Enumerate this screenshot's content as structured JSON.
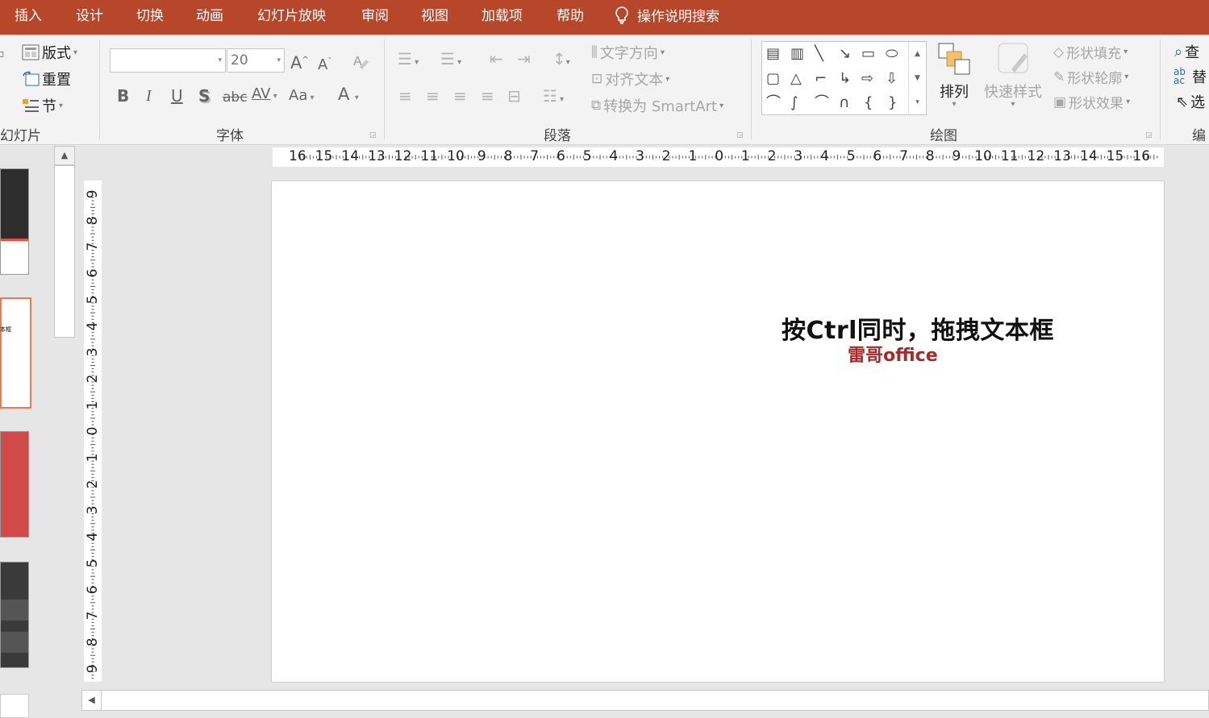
{
  "tabs": [
    "插入",
    "设计",
    "切换",
    "动画",
    "幻灯片放映",
    "审阅",
    "视图",
    "加载项",
    "帮助"
  ],
  "search_tab": {
    "icon": "lightbulb-icon",
    "label": "操作说明搜索"
  },
  "slides_group": {
    "layout": "版式",
    "reset": "重置",
    "section": "节",
    "label": "幻灯片"
  },
  "font_group": {
    "font_name": "",
    "font_size": "20",
    "grow": "A",
    "shrink": "A",
    "bold": "B",
    "italic": "I",
    "underline": "U",
    "shadow": "S",
    "strikethrough": "abc",
    "spacing": "AV",
    "case": "Aa",
    "color": "A",
    "label": "字体"
  },
  "paragraph_group": {
    "text_direction": "文字方向",
    "align_text": "对齐文本",
    "smartart": "转换为 SmartArt",
    "label": "段落"
  },
  "drawing_group": {
    "arrange": "排列",
    "quick_styles": "快速样式",
    "shape_fill": "形状填充",
    "shape_outline": "形状轮廓",
    "shape_effects": "形状效果",
    "label": "绘图"
  },
  "editing_group": {
    "find": "查",
    "replace": "替",
    "select": "选",
    "label": "编"
  },
  "hruler_numbers": [
    "16",
    "15",
    "14",
    "13",
    "12",
    "11",
    "10",
    "9",
    "8",
    "7",
    "6",
    "5",
    "4",
    "3",
    "2",
    "1",
    "0",
    "1",
    "2",
    "3",
    "4",
    "5",
    "6",
    "7",
    "8",
    "9",
    "10",
    "11",
    "12",
    "13",
    "14",
    "15",
    "16"
  ],
  "vruler_numbers": [
    "9",
    "8",
    "7",
    "6",
    "5",
    "4",
    "3",
    "2",
    "1",
    "0",
    "1",
    "2",
    "3",
    "4",
    "5",
    "6",
    "7",
    "8",
    "9"
  ],
  "thumb2_text": "本框",
  "slide": {
    "title": "按Ctrl同时，拖拽文本框",
    "subtitle": "雷哥office"
  },
  "colors": {
    "accent": "#b7472a",
    "subtitle": "#a52a2a",
    "selected_thumb_border": "#e97b53"
  }
}
